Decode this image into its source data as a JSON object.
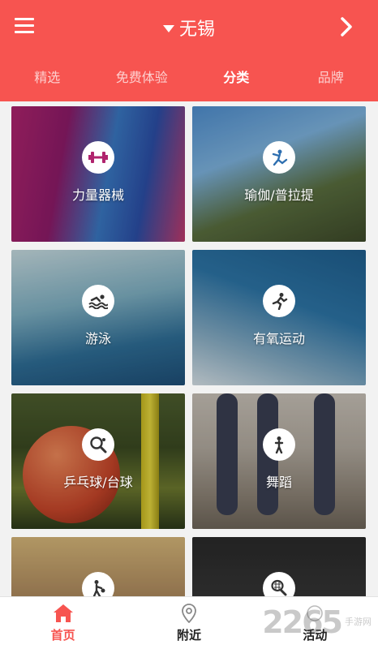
{
  "header": {
    "city": "无锡",
    "accent_color": "#f75450"
  },
  "tabs": [
    {
      "label": "精选",
      "active": false
    },
    {
      "label": "免费体验",
      "active": false
    },
    {
      "label": "分类",
      "active": true
    },
    {
      "label": "品牌",
      "active": false
    }
  ],
  "categories": [
    {
      "label": "力量器械",
      "icon": "dumbbell-icon"
    },
    {
      "label": "瑜伽/普拉提",
      "icon": "yoga-icon"
    },
    {
      "label": "游泳",
      "icon": "swimming-icon"
    },
    {
      "label": "有氧运动",
      "icon": "running-icon"
    },
    {
      "label": "乒乓球/台球",
      "icon": "table-tennis-icon"
    },
    {
      "label": "舞蹈",
      "icon": "dance-icon"
    },
    {
      "label": "",
      "icon": "ball-sport-icon"
    },
    {
      "label": "",
      "icon": "tennis-icon"
    }
  ],
  "bottom_nav": [
    {
      "label": "首页",
      "icon": "home-icon",
      "active": true
    },
    {
      "label": "附近",
      "icon": "location-pin-icon",
      "active": false
    },
    {
      "label": "活动",
      "icon": "activity-icon",
      "active": false
    }
  ],
  "watermark": {
    "number": "2265",
    "site": "手游网"
  }
}
